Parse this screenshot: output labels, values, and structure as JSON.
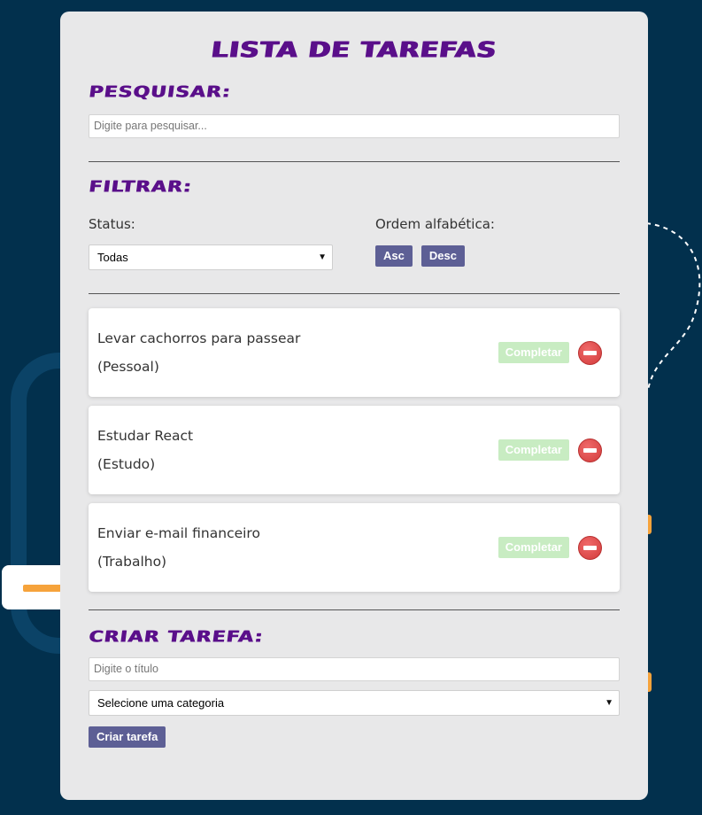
{
  "header": {
    "title": "LISTA DE TAREFAS"
  },
  "search": {
    "title": "PESQUISAR:",
    "placeholder": "Digite para pesquisar..."
  },
  "filter": {
    "title": "FILTRAR:",
    "status_label": "Status:",
    "status_selected": "Todas",
    "order_label": "Ordem alfabética:",
    "asc_label": "Asc",
    "desc_label": "Desc"
  },
  "todos": [
    {
      "title": "Levar cachorros para passear",
      "category": "(Pessoal)",
      "complete_label": "Completar"
    },
    {
      "title": "Estudar React",
      "category": "(Estudo)",
      "complete_label": "Completar"
    },
    {
      "title": "Enviar e-mail financeiro",
      "category": "(Trabalho)",
      "complete_label": "Completar"
    }
  ],
  "create": {
    "title": "CRIAR TAREFA:",
    "title_placeholder": "Digite o título",
    "category_selected": "Selecione uma categoria",
    "button_label": "Criar tarefa"
  },
  "colors": {
    "background": "#02304d",
    "accent_purple": "#5a0f8a",
    "button": "#5d5f95",
    "complete_button": "#c8ecc2",
    "remove": "#d23b3b",
    "decor_orange": "#f6a33b"
  },
  "icons": {
    "remove": "remove-icon",
    "select_arrow": "chevron-down-icon"
  }
}
